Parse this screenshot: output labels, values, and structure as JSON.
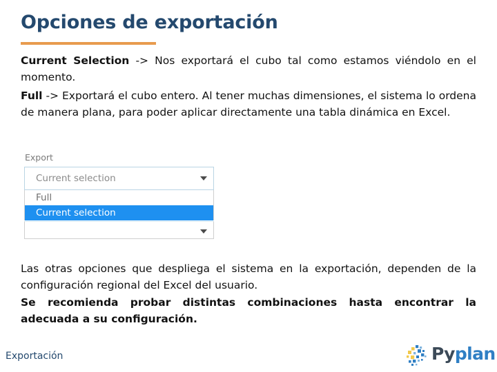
{
  "slide": {
    "title": "Opciones de exportación",
    "accent_color": "#e89b4e",
    "title_color": "#24496e"
  },
  "body": {
    "para_current_bold": "Current Selection",
    "para_current_rest": " -> Nos exportará el cubo tal como estamos viéndolo en el momento.",
    "para_full_bold": "Full",
    "para_full_rest": " -> Exportará el cubo entero. Al tener muchas dimensiones, el sistema lo ordena de manera plana, para poder aplicar directamente una tabla dinámica en Excel.",
    "para_others": "Las otras opciones que despliega el sistema en la exportación, dependen de la configuración regional del Excel del usuario.",
    "para_advice": "Se recomienda probar distintas combinaciones hasta encontrar la adecuada a su configuración."
  },
  "screenshot": {
    "export_label": "Export",
    "combo_value": "Current selection",
    "caret_icon": "chevron-down-icon",
    "options": [
      {
        "label": "Full",
        "selected": false
      },
      {
        "label": "Current selection",
        "selected": true
      }
    ],
    "highlight_color": "#1e90f0",
    "second_combo_caret_icon": "chevron-down-icon"
  },
  "footer": {
    "section_label": "Exportación",
    "logo": {
      "mark_icon": "pyplan-squares-icon",
      "word_part1": "Py",
      "word_part2": "plan",
      "color_dark": "#3c4a58",
      "color_blue": "#2f7fc4",
      "color_yellow": "#f2c94c"
    }
  }
}
